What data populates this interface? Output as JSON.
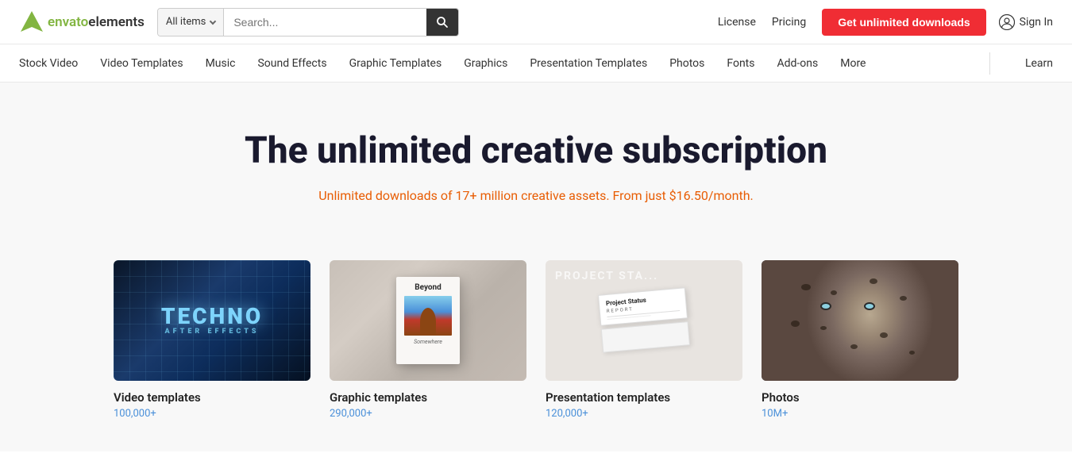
{
  "logo": {
    "text_envato": "envato",
    "text_elements": "elements"
  },
  "search": {
    "dropdown_label": "All items",
    "placeholder": "Search..."
  },
  "top_nav": {
    "license": "License",
    "pricing": "Pricing",
    "cta": "Get unlimited downloads",
    "sign_in": "Sign In"
  },
  "main_nav": {
    "items": [
      {
        "label": "Stock Video"
      },
      {
        "label": "Video Templates"
      },
      {
        "label": "Music"
      },
      {
        "label": "Sound Effects"
      },
      {
        "label": "Graphic Templates"
      },
      {
        "label": "Graphics"
      },
      {
        "label": "Presentation Templates"
      },
      {
        "label": "Photos"
      },
      {
        "label": "Fonts"
      },
      {
        "label": "Add-ons"
      },
      {
        "label": "More"
      },
      {
        "label": "Learn"
      }
    ]
  },
  "hero": {
    "title": "The unlimited creative subscription",
    "subtitle": "Unlimited downloads of 17+ million creative assets. From just $16.50/month."
  },
  "cards": [
    {
      "type": "video",
      "label": "Video templates",
      "count": "100,000+"
    },
    {
      "type": "graphic",
      "label": "Graphic templates",
      "count": "290,000+"
    },
    {
      "type": "presentation",
      "label": "Presentation templates",
      "count": "120,000+"
    },
    {
      "type": "photos",
      "label": "Photos",
      "count": "10M+"
    }
  ]
}
